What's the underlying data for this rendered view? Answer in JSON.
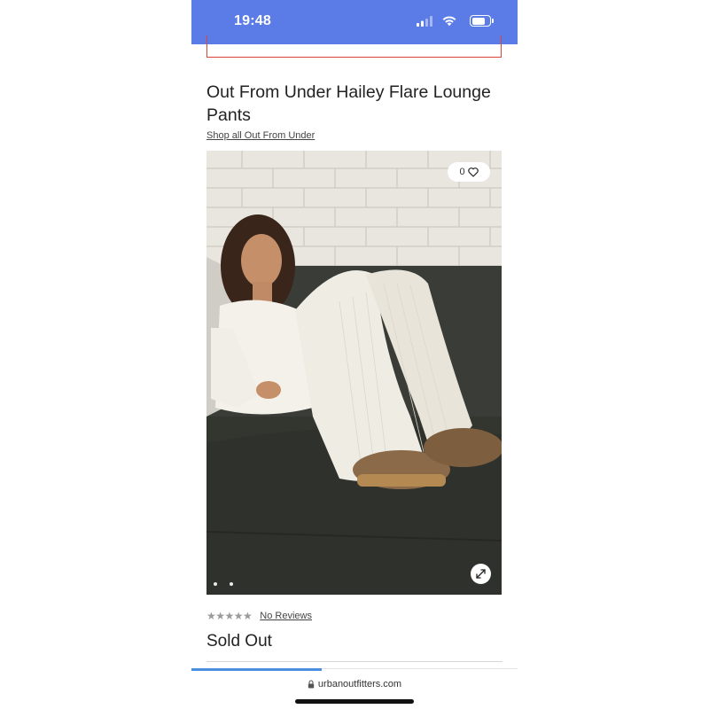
{
  "status_bar": {
    "time": "19:48",
    "icons": [
      "signal-icon",
      "wifi-icon",
      "battery-icon"
    ],
    "background": "#5b7be6"
  },
  "product": {
    "title": "Out From Under Hailey Flare Lounge Pants",
    "brand_link": "Shop all Out From Under",
    "like_count": "0",
    "image_count": 2,
    "rating": {
      "stars_filled": 0,
      "stars_total": 5,
      "stars_text": "★★★★★"
    },
    "reviews_link": "No Reviews",
    "stock_status": "Sold Out"
  },
  "browser": {
    "url": "urbanoutfitters.com",
    "load_progress": 0.4,
    "accent": "#4b8fe0"
  },
  "colors": {
    "promo_border": "#d8443c"
  }
}
